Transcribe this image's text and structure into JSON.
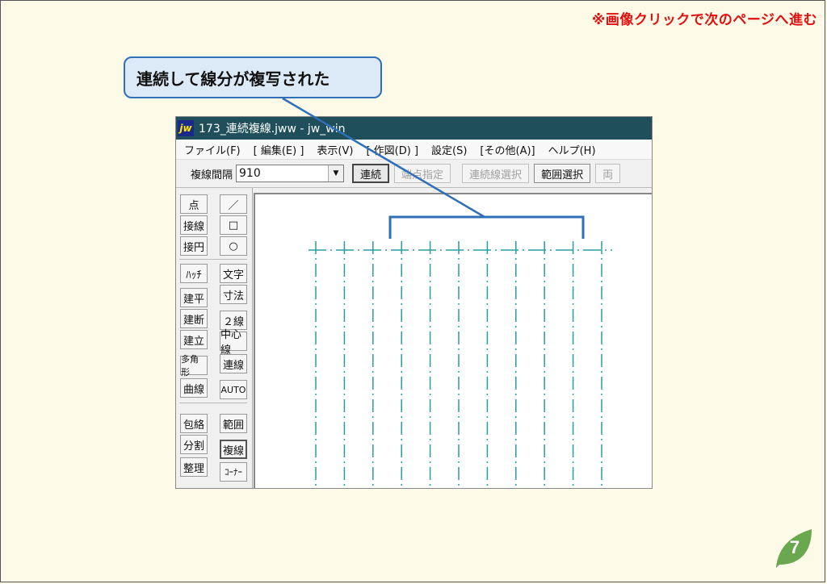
{
  "header": {
    "nav_note": "※画像クリックで次のページへ進む"
  },
  "callout": {
    "text": "連続して線分が複写された"
  },
  "window": {
    "title": "173_連続複線.jww - jw_win",
    "icon_text": "jw",
    "menu": [
      "ファイル(F)",
      "[ 編集(E) ]",
      "表示(V)",
      "[ 作図(D) ]",
      "設定(S)",
      "[その他(A)]",
      "ヘルプ(H)"
    ],
    "toolbar": {
      "spacing_label": "複線間隔",
      "spacing_value": "910",
      "buttons": [
        {
          "label": "連続",
          "state": "pressed"
        },
        {
          "label": "端点指定",
          "state": "disabled"
        },
        {
          "label": "連続線選択",
          "state": "disabled"
        },
        {
          "label": "範囲選択",
          "state": "normal"
        },
        {
          "label": "両",
          "state": "disabled"
        }
      ]
    },
    "side_left": [
      "点",
      "接線",
      "接円",
      "ﾊｯﾁ",
      "建平",
      "建断",
      "建立",
      "多角形",
      "曲線",
      "包絡",
      "分割",
      "整理"
    ],
    "side_right": [
      "／",
      "□",
      "○",
      "文字",
      "寸法",
      "２線",
      "中心線",
      "連線",
      "AUTO",
      "範囲",
      "複線",
      "ｺｰﾅｰ"
    ],
    "line_color": "#2a9d9d"
  },
  "page_number": "7",
  "colors": {
    "accent": "#e01010",
    "callout_border": "#2e6fb7",
    "leaf": "#6aa84f"
  }
}
